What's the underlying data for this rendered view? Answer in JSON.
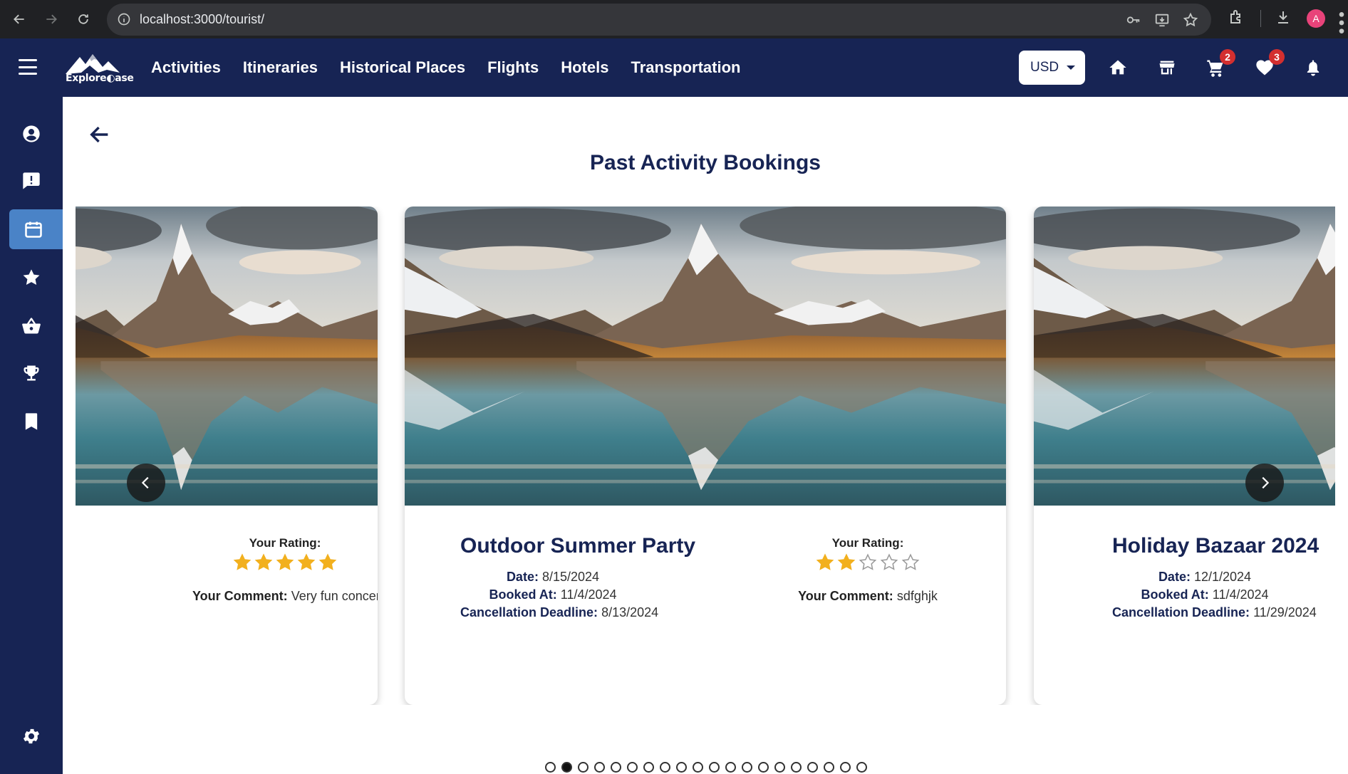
{
  "browser": {
    "url": "localhost:3000/tourist/",
    "profile_initial": "A"
  },
  "header": {
    "logo_text": "Explore◐ase",
    "nav": [
      "Activities",
      "Itineraries",
      "Historical Places",
      "Flights",
      "Hotels",
      "Transportation"
    ],
    "currency": "USD",
    "cart_count": "2",
    "wishlist_count": "3"
  },
  "sidebar": {
    "items": [
      "profile-icon",
      "complaint-icon",
      "calendar-icon",
      "star-icon",
      "basket-icon",
      "trophy-icon",
      "bookmark-icon",
      "settings-icon",
      "logout-icon"
    ],
    "active": "calendar-icon"
  },
  "page": {
    "title": "Past Activity Bookings"
  },
  "labels": {
    "your_rating": "Your Rating:",
    "your_comment": "Your Comment:",
    "date": "Date:",
    "booked_at": "Booked At:",
    "cancellation_deadline": "Cancellation Deadline:"
  },
  "cards": [
    {
      "rating": 5,
      "comment": "Very fun concert :)"
    },
    {
      "name": "Outdoor Summer Party",
      "date": "8/15/2024",
      "booked_at": "11/4/2024",
      "cancellation_deadline": "8/13/2024",
      "rating": 2,
      "comment": "sdfghjk"
    },
    {
      "name": "Holiday Bazaar 2024",
      "date": "12/1/2024",
      "booked_at": "11/4/2024",
      "cancellation_deadline": "11/29/2024"
    }
  ],
  "pagination": {
    "total": 20,
    "active_index": 1
  },
  "colors": {
    "brand_navy": "#172454",
    "sidebar_active": "#4a83c7",
    "star_filled": "#f2b01e",
    "badge": "#d32f2f"
  }
}
